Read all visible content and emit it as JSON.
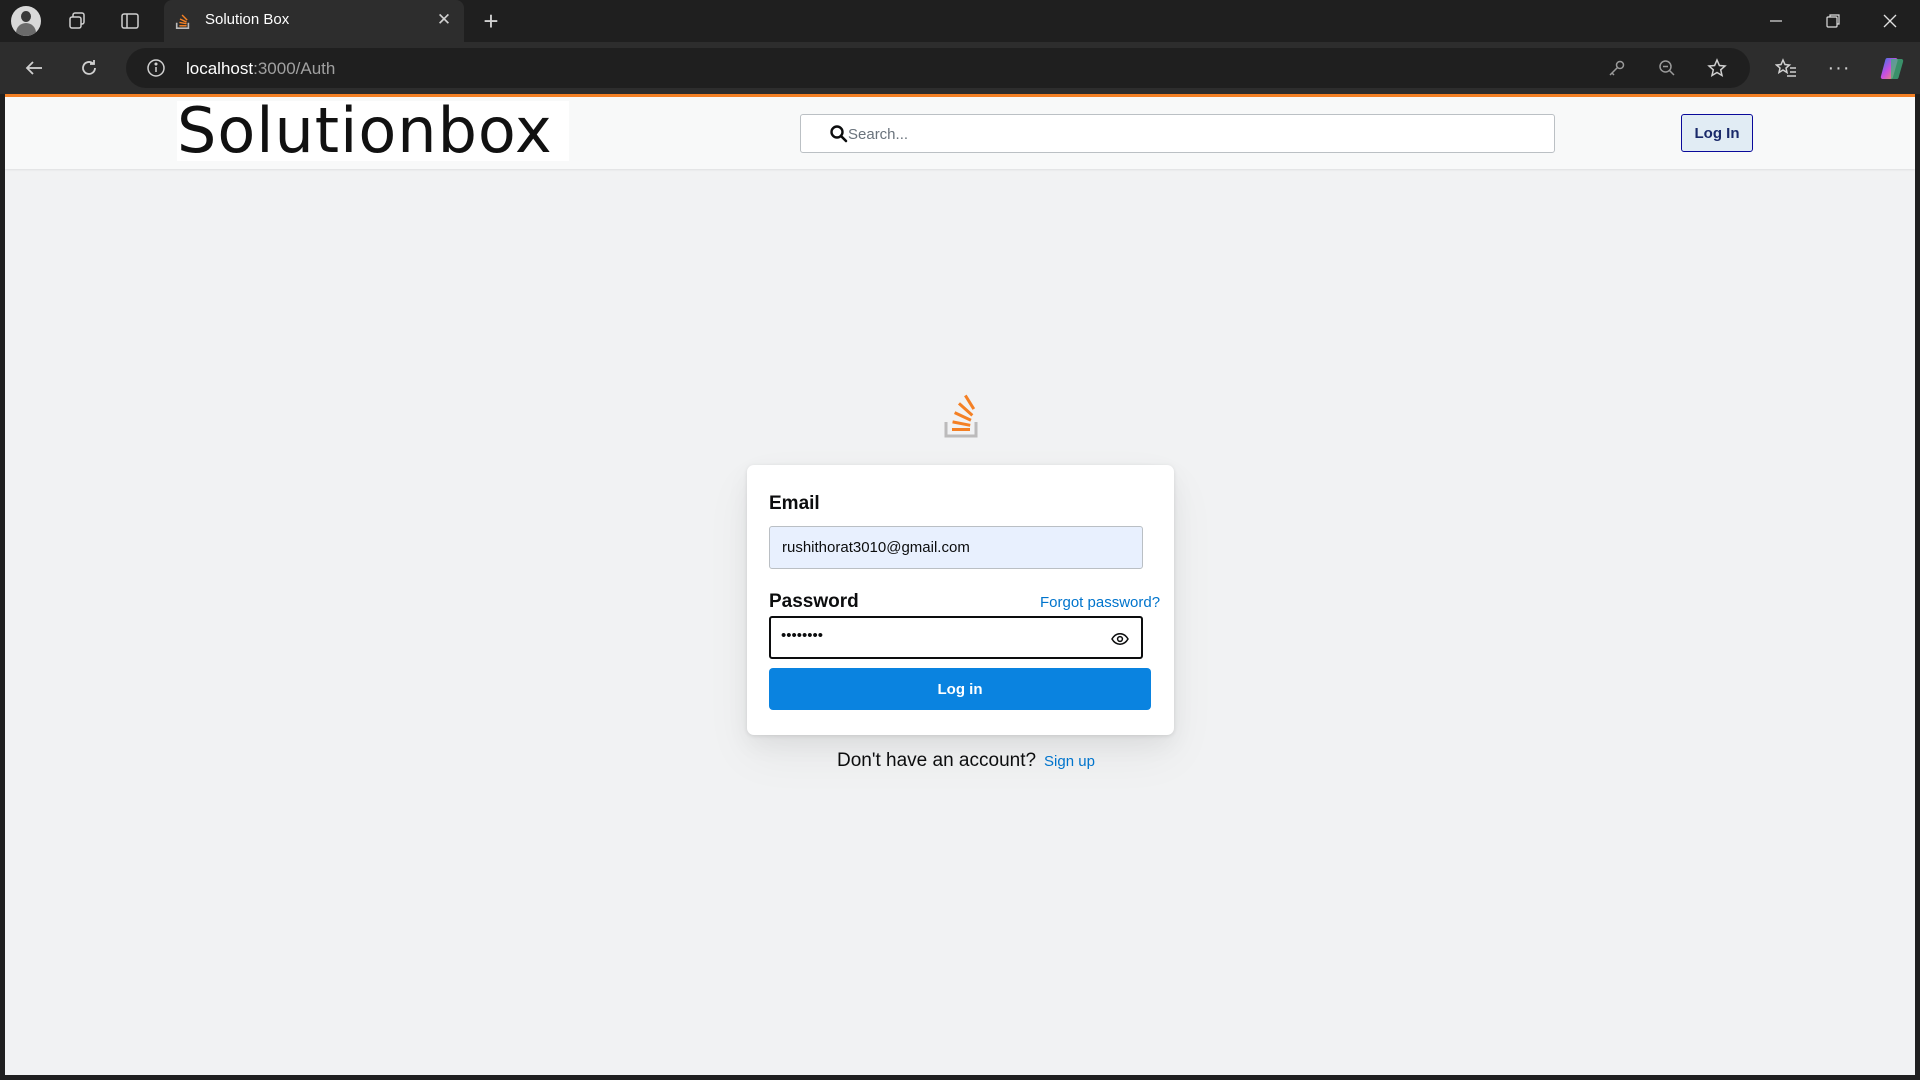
{
  "browser": {
    "tab_title": "Solution Box",
    "url_host": "localhost",
    "url_path": ":3000/Auth"
  },
  "header": {
    "logo_text": "Solutionbox",
    "search_placeholder": "Search...",
    "login_label": "Log In"
  },
  "login_form": {
    "email_label": "Email",
    "email_value": "rushithorat3010@gmail.com",
    "password_label": "Password",
    "forgot_label": "Forgot password?",
    "password_masked": "••••••••",
    "submit_label": "Log in"
  },
  "signup": {
    "question": "Don't have an account?",
    "link_label": "Sign up"
  },
  "colors": {
    "accent_orange": "#f48024",
    "primary_blue": "#0a83e0",
    "link_blue": "#0074cc"
  }
}
